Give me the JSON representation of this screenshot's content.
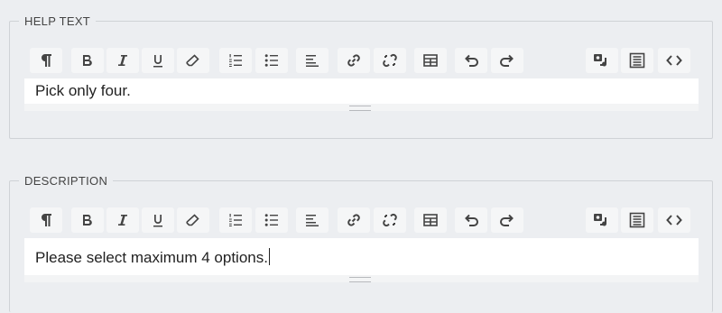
{
  "fields": [
    {
      "legend": "HELP TEXT",
      "content": "Pick only four."
    },
    {
      "legend": "DESCRIPTION",
      "content": "Please select maximum 4 options."
    }
  ],
  "toolbar_icons": [
    "paragraph-icon",
    "bold-icon",
    "italic-icon",
    "underline-icon",
    "eraser-icon",
    "numbered-list-icon",
    "bullet-list-icon",
    "align-left-icon",
    "link-icon",
    "unlink-icon",
    "table-icon",
    "undo-icon",
    "redo-icon",
    "media-icon",
    "source-list-icon",
    "code-view-icon"
  ],
  "colors": {
    "background": "#eceef1",
    "button": "#f5f6f7",
    "border": "#cfd2d6",
    "editor": "#ffffff"
  }
}
